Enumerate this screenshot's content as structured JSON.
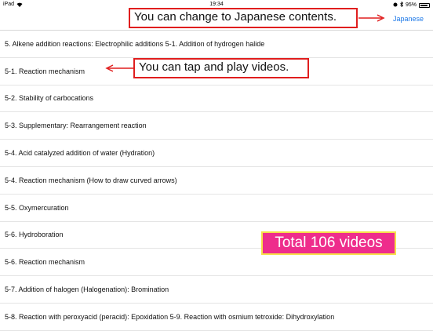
{
  "status_bar": {
    "device": "iPad",
    "time": "19:34",
    "battery": "95%"
  },
  "nav": {
    "language_link": "Japanese"
  },
  "items": [
    {
      "label": "5. Alkene addition reactions: Electrophilic additions 5-1. Addition of hydrogen halide"
    },
    {
      "label": "5-1. Reaction mechanism"
    },
    {
      "label": "5-2. Stability of carbocations"
    },
    {
      "label": "5-3. Supplementary: Rearrangement reaction"
    },
    {
      "label": "5-4. Acid catalyzed addition of water (Hydration)"
    },
    {
      "label": "5-4. Reaction mechanism (How to draw curved arrows)"
    },
    {
      "label": "5-5. Oxymercuration"
    },
    {
      "label": "5-6. Hydroboration"
    },
    {
      "label": "5-6. Reaction mechanism"
    },
    {
      "label": "5-7. Addition of halogen (Halogenation): Bromination"
    },
    {
      "label": "5-8. Reaction with peroxyacid (peracid): Epoxidation 5-9. Reaction with osmium tetroxide: Dihydroxylation"
    }
  ],
  "annotations": {
    "language_callout": "You can change to Japanese contents.",
    "video_callout": "You can tap and play videos.",
    "total_badge": "Total 106 videos"
  },
  "colors": {
    "link_blue": "#1f7ae8",
    "callout_red": "#e01e1e",
    "badge_pink": "#ee2d8c",
    "badge_border_yellow": "#f6e04a"
  }
}
